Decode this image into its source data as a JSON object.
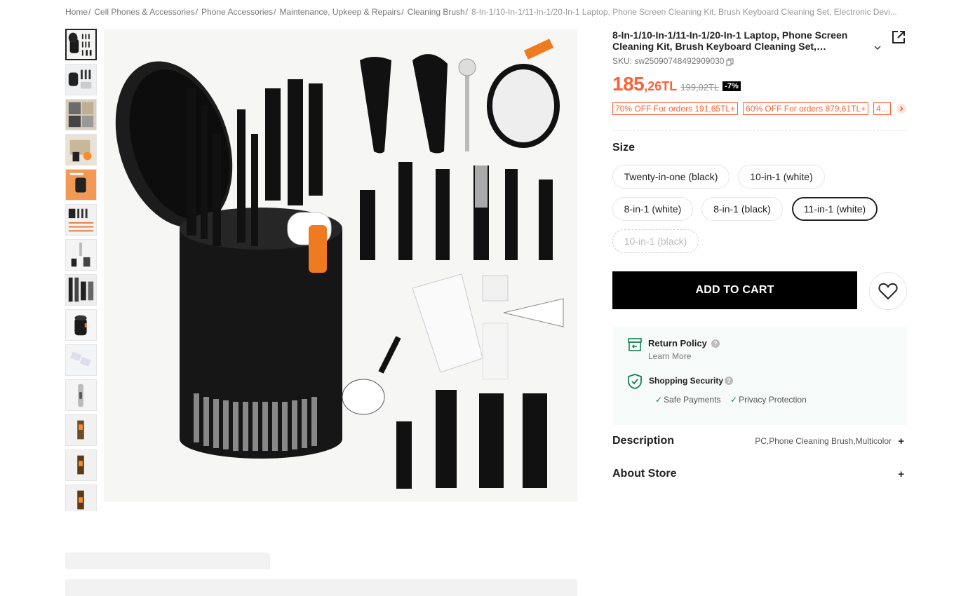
{
  "breadcrumb": {
    "items": [
      "Home",
      "Cell Phones & Accessories",
      "Phone Accessories",
      "Maintenance, Upkeep & Repairs",
      "Cleaning Brush"
    ],
    "current": "8-In-1/10-In-1/11-In-1/20-In-1 Laptop, Phone Screen Cleaning Kit, Brush Keyboard Cleaning Set, Electronic Devi..."
  },
  "product": {
    "title": "8-In-1/10-In-1/11-In-1/20-In-1 Laptop, Phone Screen Cleaning Kit, Brush Keyboard Cleaning Set, Electronic...",
    "sku": "SKU: sw25090748492909030",
    "price_int": "185",
    "price_dec": ",26TL",
    "price_old": "199,02TL",
    "discount": "-7%"
  },
  "promos": [
    "70% OFF For orders 191,65TL+",
    "60% OFF For orders 879,61TL+",
    "4..."
  ],
  "size": {
    "label": "Size",
    "options": [
      "Twenty-in-one (black)",
      "10-in-1 (white)",
      "8-in-1 (white)",
      "8-in-1 (black)",
      "11-in-1 (white)",
      "10-in-1 (black)"
    ],
    "selected": "11-in-1 (white)",
    "unavailable": "10-in-1 (black)"
  },
  "cart": {
    "add_label": "ADD TO CART"
  },
  "policy": {
    "return_title": "Return Policy",
    "learn_more": "Learn More",
    "security_title": "Shopping Security",
    "safe_payments": "Safe Payments",
    "privacy": "Privacy Protection"
  },
  "sections": {
    "description": "Description",
    "description_summary": "PC,Phone Cleaning Brush,Multicolor",
    "about_store": "About Store"
  },
  "colors": {
    "accent_price": "#fa6338",
    "primary_button": "#000000",
    "policy_bg": "#f6faf8",
    "check_green": "#198055"
  },
  "icons": [
    "share-icon",
    "chevron-down-icon",
    "copy-icon",
    "chevron-right-icon",
    "heart-icon",
    "return-box-icon",
    "shield-check-icon",
    "help-icon",
    "check-icon",
    "plus-icon"
  ]
}
